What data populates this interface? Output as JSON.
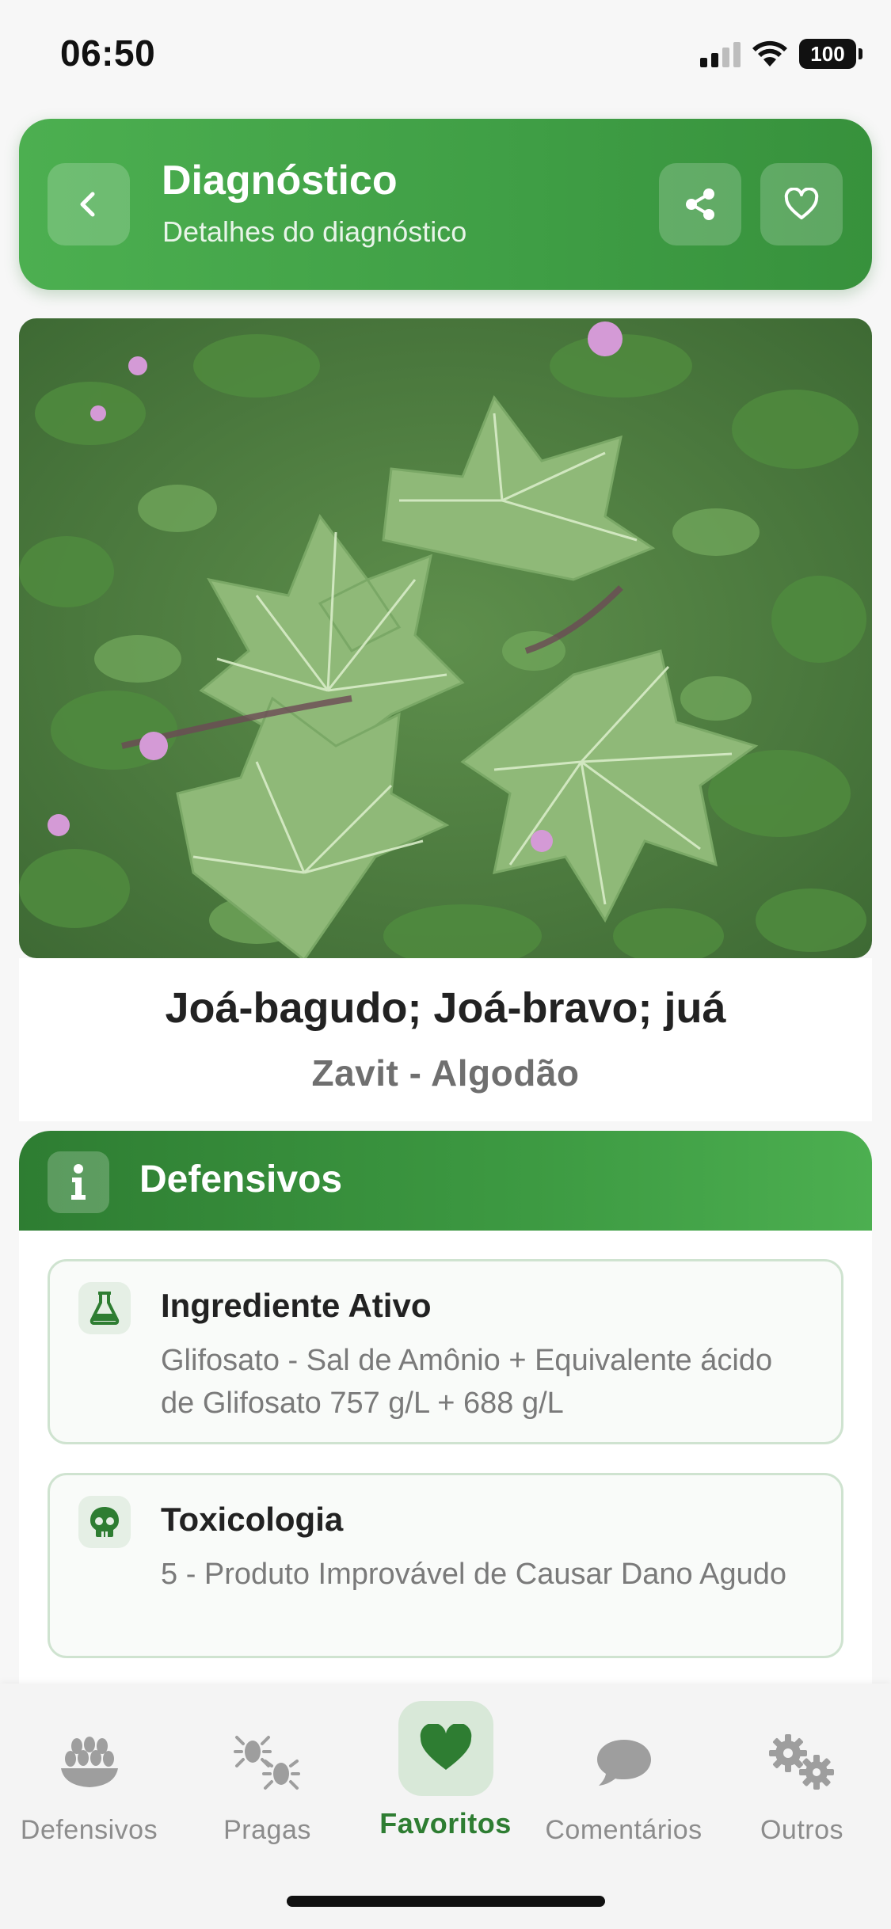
{
  "status_bar": {
    "time": "06:50",
    "battery": "100"
  },
  "header": {
    "title": "Diagnóstico",
    "subtitle": "Detalhes do diagnóstico"
  },
  "diagnosis": {
    "common_names": "Joá-bagudo; Joá-bravo; juá",
    "product_crop": "Zavit - Algodão"
  },
  "section": {
    "title": "Defensivos",
    "items": [
      {
        "label": "Ingrediente Ativo",
        "value": "Glifosato - Sal de Amônio + Equivalente ácido de Glifosato 757 g/L + 688 g/L",
        "icon": "flask-icon"
      },
      {
        "label": "Toxicologia",
        "value": "5 - Produto Improvável de Causar Dano Agudo",
        "icon": "skull-icon"
      }
    ]
  },
  "nav": {
    "items": [
      {
        "label": "Defensivos",
        "icon": "seeds-icon"
      },
      {
        "label": "Pragas",
        "icon": "bugs-icon"
      },
      {
        "label": "Favoritos",
        "icon": "heart-icon",
        "active": true
      },
      {
        "label": "Comentários",
        "icon": "comment-icon"
      },
      {
        "label": "Outros",
        "icon": "gears-icon"
      }
    ]
  },
  "colors": {
    "primary": "#4caf50",
    "primary_dark": "#2e7d32",
    "muted": "#8c8c8c"
  }
}
